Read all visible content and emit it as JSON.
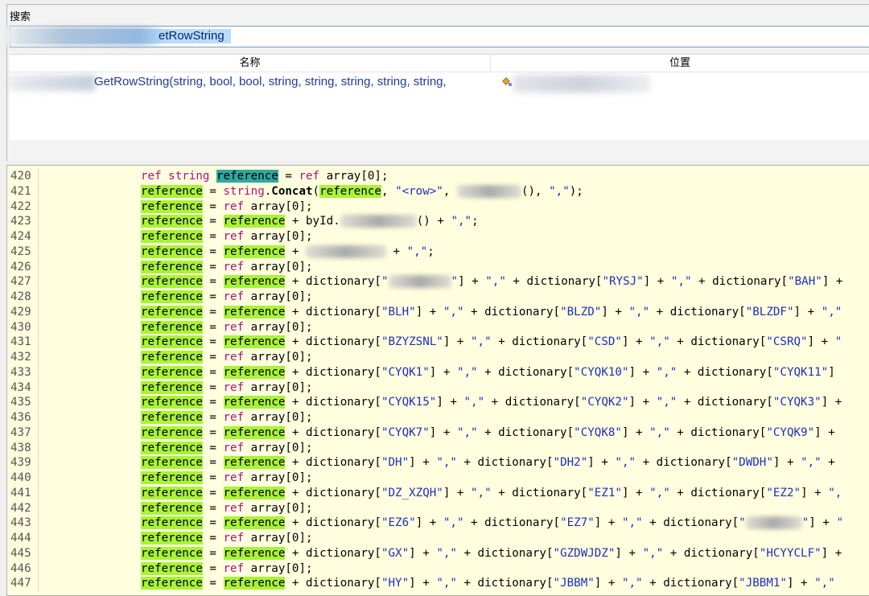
{
  "search": {
    "label": "搜索",
    "value_visible": "etRowString"
  },
  "results": {
    "columns": [
      "名称",
      "位置"
    ],
    "rows": [
      {
        "name": "GetRowString(string, bool, bool, string, string, string, string, string,"
      }
    ]
  },
  "code": {
    "lines": [
      {
        "no": "420",
        "tokens": [
          [
            "kw",
            "ref"
          ],
          [
            "t",
            " "
          ],
          [
            "ty",
            "string"
          ],
          [
            "t",
            " "
          ],
          [
            "sel",
            "reference"
          ],
          [
            "t",
            " = "
          ],
          [
            "kw",
            "ref"
          ],
          [
            "t",
            " array[0];"
          ]
        ]
      },
      {
        "no": "421",
        "tokens": [
          [
            "hl",
            "reference"
          ],
          [
            "t",
            " = "
          ],
          [
            "ty",
            "string"
          ],
          [
            "t",
            "."
          ],
          [
            "m",
            "Concat"
          ],
          [
            "t",
            "("
          ],
          [
            "hl",
            "reference"
          ],
          [
            "t",
            ", "
          ],
          [
            "s",
            "\"<row>\""
          ],
          [
            "t",
            ", "
          ],
          [
            "r",
            "80"
          ],
          [
            "t",
            "(), "
          ],
          [
            "s",
            "\",\""
          ],
          [
            "t",
            ");"
          ]
        ]
      },
      {
        "no": "422",
        "tokens": [
          [
            "hl",
            "reference"
          ],
          [
            "t",
            " = "
          ],
          [
            "kw",
            "ref"
          ],
          [
            "t",
            " array[0];"
          ]
        ]
      },
      {
        "no": "423",
        "tokens": [
          [
            "hl",
            "reference"
          ],
          [
            "t",
            " = "
          ],
          [
            "hl",
            "reference"
          ],
          [
            "t",
            " + byId."
          ],
          [
            "r",
            "95"
          ],
          [
            "t",
            "() + "
          ],
          [
            "s",
            "\",\""
          ],
          [
            "t",
            ";"
          ]
        ]
      },
      {
        "no": "424",
        "tokens": [
          [
            "hl",
            "reference"
          ],
          [
            "t",
            " = "
          ],
          [
            "kw",
            "ref"
          ],
          [
            "t",
            " array[0];"
          ]
        ]
      },
      {
        "no": "425",
        "tokens": [
          [
            "hl",
            "reference"
          ],
          [
            "t",
            " = "
          ],
          [
            "hl",
            "reference"
          ],
          [
            "t",
            " + "
          ],
          [
            "r",
            "100"
          ],
          [
            "t",
            " + "
          ],
          [
            "s",
            "\",\""
          ],
          [
            "t",
            ";"
          ]
        ]
      },
      {
        "no": "426",
        "tokens": [
          [
            "hl",
            "reference"
          ],
          [
            "t",
            " = "
          ],
          [
            "kw",
            "ref"
          ],
          [
            "t",
            " array[0];"
          ]
        ]
      },
      {
        "no": "427",
        "tokens": [
          [
            "hl",
            "reference"
          ],
          [
            "t",
            " = "
          ],
          [
            "hl",
            "reference"
          ],
          [
            "t",
            " + dictionary["
          ],
          [
            "s",
            "\""
          ],
          [
            "r",
            "78"
          ],
          [
            "s",
            "\""
          ],
          [
            "t",
            "] + "
          ],
          [
            "s",
            "\",\""
          ],
          [
            "t",
            " + dictionary["
          ],
          [
            "s",
            "\"RYSJ\""
          ],
          [
            "t",
            "] + "
          ],
          [
            "s",
            "\",\""
          ],
          [
            "t",
            " + dictionary["
          ],
          [
            "s",
            "\"BAH\""
          ],
          [
            "t",
            "] +"
          ]
        ]
      },
      {
        "no": "428",
        "tokens": [
          [
            "hl",
            "reference"
          ],
          [
            "t",
            " = "
          ],
          [
            "kw",
            "ref"
          ],
          [
            "t",
            " array[0];"
          ]
        ]
      },
      {
        "no": "429",
        "tokens": [
          [
            "hl",
            "reference"
          ],
          [
            "t",
            " = "
          ],
          [
            "hl",
            "reference"
          ],
          [
            "t",
            " + dictionary["
          ],
          [
            "s",
            "\"BLH\""
          ],
          [
            "t",
            "] + "
          ],
          [
            "s",
            "\",\""
          ],
          [
            "t",
            " + dictionary["
          ],
          [
            "s",
            "\"BLZD\""
          ],
          [
            "t",
            "] + "
          ],
          [
            "s",
            "\",\""
          ],
          [
            "t",
            " + dictionary["
          ],
          [
            "s",
            "\"BLZDF\""
          ],
          [
            "t",
            "] + "
          ],
          [
            "s",
            "\",\""
          ]
        ]
      },
      {
        "no": "430",
        "tokens": [
          [
            "hl",
            "reference"
          ],
          [
            "t",
            " = "
          ],
          [
            "kw",
            "ref"
          ],
          [
            "t",
            " array[0];"
          ]
        ]
      },
      {
        "no": "431",
        "tokens": [
          [
            "hl",
            "reference"
          ],
          [
            "t",
            " = "
          ],
          [
            "hl",
            "reference"
          ],
          [
            "t",
            " + dictionary["
          ],
          [
            "s",
            "\"BZYZSNL\""
          ],
          [
            "t",
            "] + "
          ],
          [
            "s",
            "\",\""
          ],
          [
            "t",
            " + dictionary["
          ],
          [
            "s",
            "\"CSD\""
          ],
          [
            "t",
            "] + "
          ],
          [
            "s",
            "\",\""
          ],
          [
            "t",
            " + dictionary["
          ],
          [
            "s",
            "\"CSRQ\""
          ],
          [
            "t",
            "] + "
          ],
          [
            "s",
            "\""
          ]
        ]
      },
      {
        "no": "432",
        "tokens": [
          [
            "hl",
            "reference"
          ],
          [
            "t",
            " = "
          ],
          [
            "kw",
            "ref"
          ],
          [
            "t",
            " array[0];"
          ]
        ]
      },
      {
        "no": "433",
        "tokens": [
          [
            "hl",
            "reference"
          ],
          [
            "t",
            " = "
          ],
          [
            "hl",
            "reference"
          ],
          [
            "t",
            " + dictionary["
          ],
          [
            "s",
            "\"CYQK1\""
          ],
          [
            "t",
            "] + "
          ],
          [
            "s",
            "\",\""
          ],
          [
            "t",
            " + dictionary["
          ],
          [
            "s",
            "\"CYQK10\""
          ],
          [
            "t",
            "] + "
          ],
          [
            "s",
            "\",\""
          ],
          [
            "t",
            " + dictionary["
          ],
          [
            "s",
            "\"CYQK11\""
          ],
          [
            "t",
            "]"
          ]
        ]
      },
      {
        "no": "434",
        "tokens": [
          [
            "hl",
            "reference"
          ],
          [
            "t",
            " = "
          ],
          [
            "kw",
            "ref"
          ],
          [
            "t",
            " array[0];"
          ]
        ]
      },
      {
        "no": "435",
        "tokens": [
          [
            "hl",
            "reference"
          ],
          [
            "t",
            " = "
          ],
          [
            "hl",
            "reference"
          ],
          [
            "t",
            " + dictionary["
          ],
          [
            "s",
            "\"CYQK15\""
          ],
          [
            "t",
            "] + "
          ],
          [
            "s",
            "\",\""
          ],
          [
            "t",
            " + dictionary["
          ],
          [
            "s",
            "\"CYQK2\""
          ],
          [
            "t",
            "] + "
          ],
          [
            "s",
            "\",\""
          ],
          [
            "t",
            " + dictionary["
          ],
          [
            "s",
            "\"CYQK3\""
          ],
          [
            "t",
            "] +"
          ]
        ]
      },
      {
        "no": "436",
        "tokens": [
          [
            "hl",
            "reference"
          ],
          [
            "t",
            " = "
          ],
          [
            "kw",
            "ref"
          ],
          [
            "t",
            " array[0];"
          ]
        ]
      },
      {
        "no": "437",
        "tokens": [
          [
            "hl",
            "reference"
          ],
          [
            "t",
            " = "
          ],
          [
            "hl",
            "reference"
          ],
          [
            "t",
            " + dictionary["
          ],
          [
            "s",
            "\"CYQK7\""
          ],
          [
            "t",
            "] + "
          ],
          [
            "s",
            "\",\""
          ],
          [
            "t",
            " + dictionary["
          ],
          [
            "s",
            "\"CYQK8\""
          ],
          [
            "t",
            "] + "
          ],
          [
            "s",
            "\",\""
          ],
          [
            "t",
            " + dictionary["
          ],
          [
            "s",
            "\"CYQK9\""
          ],
          [
            "t",
            "] +"
          ]
        ]
      },
      {
        "no": "438",
        "tokens": [
          [
            "hl",
            "reference"
          ],
          [
            "t",
            " = "
          ],
          [
            "kw",
            "ref"
          ],
          [
            "t",
            " array[0];"
          ]
        ]
      },
      {
        "no": "439",
        "tokens": [
          [
            "hl",
            "reference"
          ],
          [
            "t",
            " = "
          ],
          [
            "hl",
            "reference"
          ],
          [
            "t",
            " + dictionary["
          ],
          [
            "s",
            "\"DH\""
          ],
          [
            "t",
            "] + "
          ],
          [
            "s",
            "\",\""
          ],
          [
            "t",
            " + dictionary["
          ],
          [
            "s",
            "\"DH2\""
          ],
          [
            "t",
            "] + "
          ],
          [
            "s",
            "\",\""
          ],
          [
            "t",
            " + dictionary["
          ],
          [
            "s",
            "\"DWDH\""
          ],
          [
            "t",
            "] + "
          ],
          [
            "s",
            "\",\""
          ],
          [
            "t",
            " +"
          ]
        ]
      },
      {
        "no": "440",
        "tokens": [
          [
            "hl",
            "reference"
          ],
          [
            "t",
            " = "
          ],
          [
            "kw",
            "ref"
          ],
          [
            "t",
            " array[0];"
          ]
        ]
      },
      {
        "no": "441",
        "tokens": [
          [
            "hl",
            "reference"
          ],
          [
            "t",
            " = "
          ],
          [
            "hl",
            "reference"
          ],
          [
            "t",
            " + dictionary["
          ],
          [
            "s",
            "\"DZ_XZQH\""
          ],
          [
            "t",
            "] + "
          ],
          [
            "s",
            "\",\""
          ],
          [
            "t",
            " + dictionary["
          ],
          [
            "s",
            "\"EZ1\""
          ],
          [
            "t",
            "] + "
          ],
          [
            "s",
            "\",\""
          ],
          [
            "t",
            " + dictionary["
          ],
          [
            "s",
            "\"EZ2\""
          ],
          [
            "t",
            "] + "
          ],
          [
            "s",
            "\","
          ]
        ]
      },
      {
        "no": "442",
        "tokens": [
          [
            "hl",
            "reference"
          ],
          [
            "t",
            " = "
          ],
          [
            "kw",
            "ref"
          ],
          [
            "t",
            " array[0];"
          ]
        ]
      },
      {
        "no": "443",
        "tokens": [
          [
            "hl",
            "reference"
          ],
          [
            "t",
            " = "
          ],
          [
            "hl",
            "reference"
          ],
          [
            "t",
            " + dictionary["
          ],
          [
            "s",
            "\"EZ6\""
          ],
          [
            "t",
            "] + "
          ],
          [
            "s",
            "\",\""
          ],
          [
            "t",
            " + dictionary["
          ],
          [
            "s",
            "\"EZ7\""
          ],
          [
            "t",
            "] + "
          ],
          [
            "s",
            "\",\""
          ],
          [
            "t",
            " + dictionary["
          ],
          [
            "s",
            "\""
          ],
          [
            "r",
            "70"
          ],
          [
            "s",
            "\""
          ],
          [
            "t",
            "] + "
          ],
          [
            "s",
            "\""
          ]
        ]
      },
      {
        "no": "444",
        "tokens": [
          [
            "hl",
            "reference"
          ],
          [
            "t",
            " = "
          ],
          [
            "kw",
            "ref"
          ],
          [
            "t",
            " array[0];"
          ]
        ]
      },
      {
        "no": "445",
        "tokens": [
          [
            "hl",
            "reference"
          ],
          [
            "t",
            " = "
          ],
          [
            "hl",
            "reference"
          ],
          [
            "t",
            " + dictionary["
          ],
          [
            "s",
            "\"GX\""
          ],
          [
            "t",
            "] + "
          ],
          [
            "s",
            "\",\""
          ],
          [
            "t",
            " + dictionary["
          ],
          [
            "s",
            "\"GZDWJDZ\""
          ],
          [
            "t",
            "] + "
          ],
          [
            "s",
            "\",\""
          ],
          [
            "t",
            " + dictionary["
          ],
          [
            "s",
            "\"HCYYCLF\""
          ],
          [
            "t",
            "] +"
          ]
        ]
      },
      {
        "no": "446",
        "tokens": [
          [
            "hl",
            "reference"
          ],
          [
            "t",
            " = "
          ],
          [
            "kw",
            "ref"
          ],
          [
            "t",
            " array[0];"
          ]
        ]
      },
      {
        "no": "447",
        "tokens": [
          [
            "hl",
            "reference"
          ],
          [
            "t",
            " = "
          ],
          [
            "hl",
            "reference"
          ],
          [
            "t",
            " + dictionary["
          ],
          [
            "s",
            "\"HY\""
          ],
          [
            "t",
            "] + "
          ],
          [
            "s",
            "\",\""
          ],
          [
            "t",
            " + dictionary["
          ],
          [
            "s",
            "\"JBBM\""
          ],
          [
            "t",
            "] + "
          ],
          [
            "s",
            "\",\""
          ],
          [
            "t",
            " + dictionary["
          ],
          [
            "s",
            "\"JBBM1\""
          ],
          [
            "t",
            "] + "
          ],
          [
            "s",
            "\",\""
          ]
        ]
      }
    ]
  },
  "colors": {
    "code_background": "#ffffdf",
    "highlight": "#a9f339",
    "selected_highlight": "#2ea8a0",
    "keyword": "#b0117e",
    "string": "#1d2ebd"
  }
}
